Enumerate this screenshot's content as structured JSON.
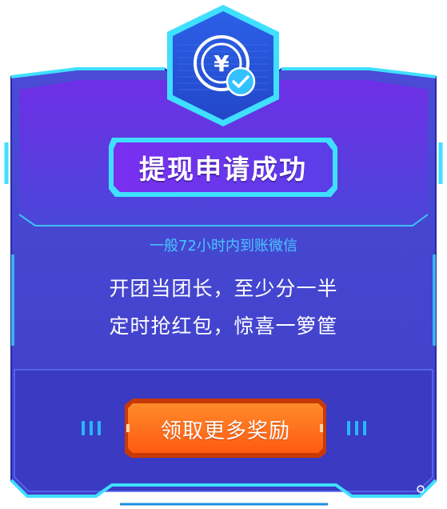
{
  "dialog": {
    "title": "提现申请成功",
    "subtitle": "一般72小时内到账微信",
    "promo_line1": "开团当团长，至少分一半",
    "promo_line2": "定时抢红包，惊喜一箩筐",
    "cta_label": "领取更多奖励",
    "icon": "yuan-coin-icon",
    "badge_icon": "checkmark-icon"
  },
  "colors": {
    "panel": "#4a4fd8",
    "panel_top": "#6a36e6",
    "frame_cyan": "#3fe0ff",
    "subtitle": "#48c6ff",
    "cta_orange": "#ff6a1a"
  }
}
